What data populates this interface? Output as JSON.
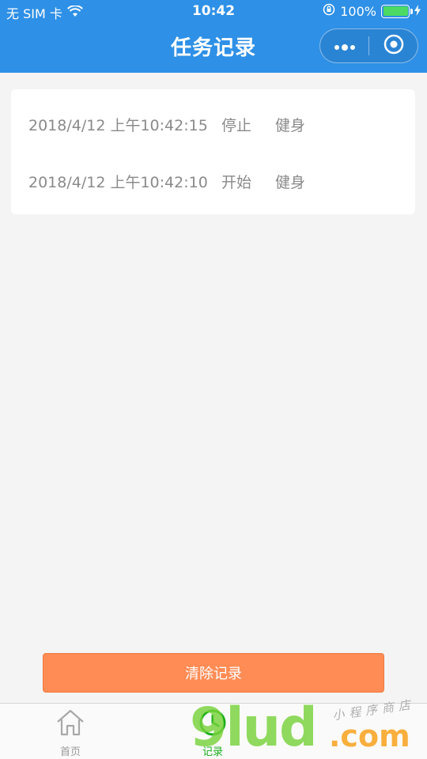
{
  "status_bar": {
    "carrier": "无 SIM 卡",
    "time": "10:42",
    "battery_percent": "100%",
    "battery_level": 1.0
  },
  "nav": {
    "title": "任务记录",
    "more_icon": "more-dots-icon",
    "close_icon": "miniprogram-close-icon"
  },
  "records": [
    {
      "time": "2018/4/12 上午10:42:15",
      "action": "停止",
      "task": "健身"
    },
    {
      "time": "2018/4/12 上午10:42:10",
      "action": "开始",
      "task": "健身"
    }
  ],
  "clear_button": {
    "label": "清除记录",
    "color": "#ff8c55"
  },
  "tab_bar": {
    "items": [
      {
        "label": "首页",
        "icon": "home-icon",
        "active": false
      },
      {
        "label": "记录",
        "icon": "clock-icon",
        "active": true
      }
    ]
  },
  "watermark": {
    "logo": "9lud",
    "suffix": ".com",
    "subtitle": "小程序商店"
  },
  "colors": {
    "header": "#2e90e6",
    "background": "#f4f4f4",
    "active_tab": "#1aad19"
  }
}
